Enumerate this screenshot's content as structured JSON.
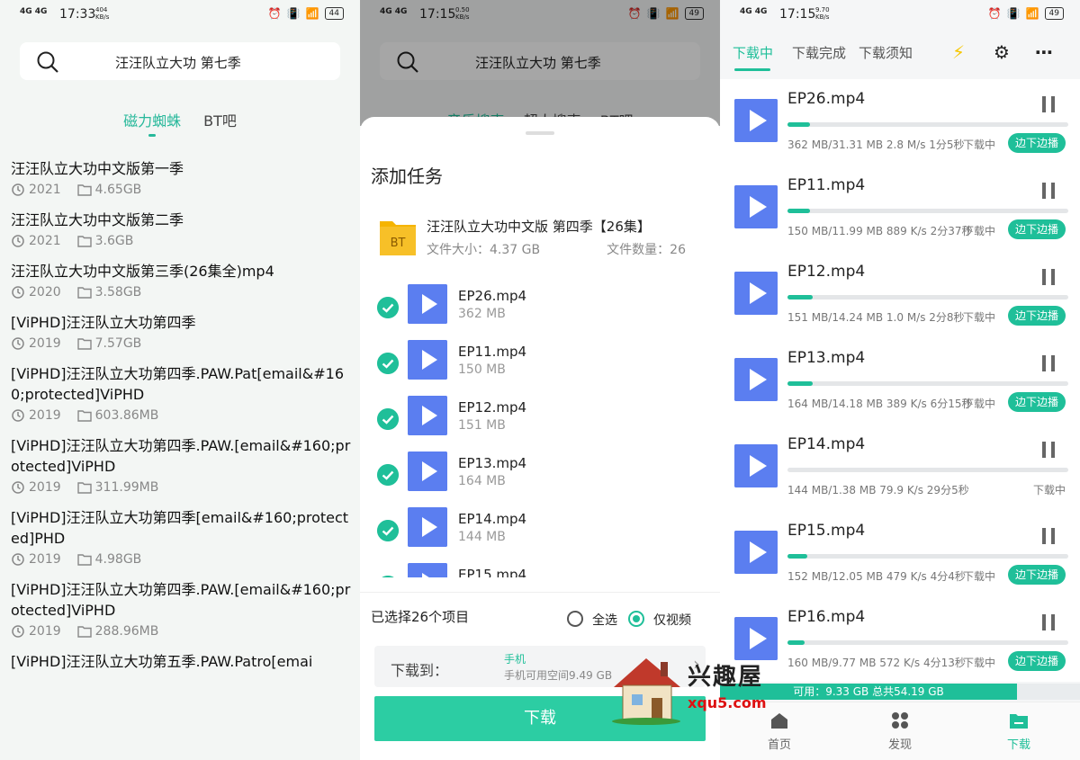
{
  "colors": {
    "accent": "#1fbf99",
    "video": "#5b7ef0",
    "folder": "#f5b400"
  },
  "p1": {
    "status": {
      "signal": "4G 4G",
      "time": "17:33",
      "speed": "404\nKB/s",
      "battery": "44"
    },
    "search": {
      "query": "汪汪队立大功 第七季"
    },
    "tabs": [
      "磁力蜘蛛",
      "BT吧"
    ],
    "results": [
      {
        "title": "汪汪队立大功中文版第一季",
        "year": "2021",
        "size": "4.65GB"
      },
      {
        "title": "汪汪队立大功中文版第二季",
        "year": "2021",
        "size": "3.6GB"
      },
      {
        "title": "汪汪队立大功中文版第三季(26集全)mp4",
        "year": "2020",
        "size": "3.58GB"
      },
      {
        "title": "[ViPHD]汪汪队立大功第四季",
        "year": "2019",
        "size": "7.57GB"
      },
      {
        "title": "[ViPHD]汪汪队立大功第四季.PAW.Pat[email&#160;protected]ViPHD",
        "year": "2019",
        "size": "603.86MB"
      },
      {
        "title": "[ViPHD]汪汪队立大功第四季.PAW.[email&#160;protected]ViPHD",
        "year": "2019",
        "size": "311.99MB"
      },
      {
        "title": "[ViPHD]汪汪队立大功第四季[email&#160;protected]PHD",
        "year": "2019",
        "size": "4.98GB"
      },
      {
        "title": "[ViPHD]汪汪队立大功第四季.PAW.[email&#160;protected]ViPHD",
        "year": "2019",
        "size": "288.96MB"
      },
      {
        "title": "[ViPHD]汪汪队立大功第五季.PAW.Patro[emai",
        "year": "",
        "size": ""
      }
    ]
  },
  "p2": {
    "status": {
      "signal": "4G 4G",
      "time": "17:15",
      "speed": "0.50\nKB/s",
      "battery": "49"
    },
    "search": {
      "query": "汪汪队立大功 第七季"
    },
    "bgtabs": [
      "音乐搜索",
      "超人搜索",
      "BT吧"
    ],
    "sheet": {
      "title": "添加任务",
      "folder_name": "汪汪队立大功中文版 第四季【26集】",
      "folder_size": "文件大小：4.37 GB",
      "folder_count": "文件数量：26",
      "files": [
        {
          "name": "EP26.mp4",
          "size": "362 MB"
        },
        {
          "name": "EP11.mp4",
          "size": "150 MB"
        },
        {
          "name": "EP12.mp4",
          "size": "151 MB"
        },
        {
          "name": "EP13.mp4",
          "size": "164 MB"
        },
        {
          "name": "EP14.mp4",
          "size": "144 MB"
        },
        {
          "name": "EP15.mp4",
          "size": ""
        }
      ],
      "selected": "已选择26个项目",
      "select_all": "全选",
      "video_only": "仅视频",
      "dest_label": "下载到：",
      "dest_name": "手机",
      "dest_space": "手机可用空间9.49 GB",
      "download": "下载"
    }
  },
  "p3": {
    "status": {
      "signal": "4G 4G",
      "time": "17:15",
      "speed": "9.70\nKB/s",
      "battery": "49"
    },
    "tabs": [
      "下载中",
      "下载完成",
      "下载须知"
    ],
    "items": [
      {
        "name": "EP26.mp4",
        "progress": 0.08,
        "info": "362 MB/31.31 MB  2.8 M/s  1分5秒",
        "state": "下载中",
        "play": "边下边播"
      },
      {
        "name": "EP11.mp4",
        "progress": 0.08,
        "info": "150 MB/11.99 MB  889 K/s  2分37秒",
        "state": "下载中",
        "play": "边下边播"
      },
      {
        "name": "EP12.mp4",
        "progress": 0.09,
        "info": "151 MB/14.24 MB  1.0 M/s  2分8秒",
        "state": "下载中",
        "play": "边下边播"
      },
      {
        "name": "EP13.mp4",
        "progress": 0.09,
        "info": "164 MB/14.18 MB  389 K/s  6分15秒",
        "state": "下载中",
        "play": "边下边播"
      },
      {
        "name": "EP14.mp4",
        "progress": 0.0,
        "info": "144 MB/1.38 MB  79.9 K/s  29分5秒",
        "state": "下载中",
        "play": ""
      },
      {
        "name": "EP15.mp4",
        "progress": 0.07,
        "info": "152 MB/12.05 MB  479 K/s  4分4秒",
        "state": "下载中",
        "play": "边下边播"
      },
      {
        "name": "EP16.mp4",
        "progress": 0.06,
        "info": "160 MB/9.77 MB  572 K/s  4分13秒",
        "state": "下载中",
        "play": "边下边播"
      }
    ],
    "storage": "可用：9.33 GB 总共54.19 GB",
    "nav": [
      "首页",
      "发现",
      "下载"
    ]
  },
  "watermark": {
    "cn": "兴趣屋",
    "url": "xqu5.com"
  }
}
